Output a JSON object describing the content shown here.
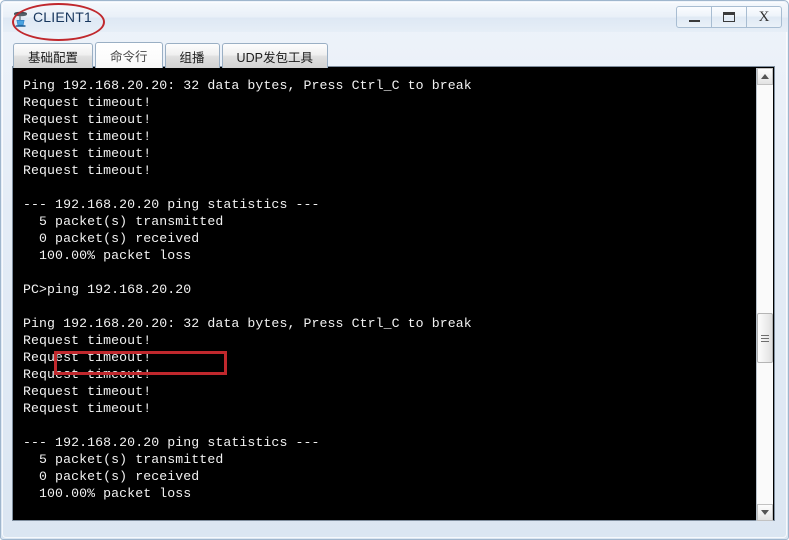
{
  "window": {
    "title": "CLIENT1",
    "icon": "pc-device-icon",
    "controls": {
      "minimize_label": "—",
      "maximize_label": "❐",
      "close_label": "X",
      "minimize_name": "minimize",
      "maximize_name": "maximize",
      "close_name": "close"
    },
    "frame_color": "#9fb6cd",
    "title_color": "#17365d"
  },
  "annotations": {
    "title_ellipse_color": "#c0282d",
    "command_box_color": "#c0282d",
    "command_box_target": "ping 192.168.20.20"
  },
  "tabs": [
    {
      "label": "基础配置",
      "name": "tab-basic-config",
      "active": false
    },
    {
      "label": "命令行",
      "name": "tab-command-line",
      "active": true
    },
    {
      "label": "组播",
      "name": "tab-multicast",
      "active": false
    },
    {
      "label": "UDP发包工具",
      "name": "tab-udp-tool",
      "active": false
    }
  ],
  "terminal": {
    "background": "#000000",
    "foreground": "#f2f2f2",
    "lines": [
      "Ping 192.168.20.20: 32 data bytes, Press Ctrl_C to break",
      "Request timeout!",
      "Request timeout!",
      "Request timeout!",
      "Request timeout!",
      "Request timeout!",
      "",
      "--- 192.168.20.20 ping statistics ---",
      "  5 packet(s) transmitted",
      "  0 packet(s) received",
      "  100.00% packet loss",
      "",
      "PC>ping 192.168.20.20",
      "",
      "Ping 192.168.20.20: 32 data bytes, Press Ctrl_C to break",
      "Request timeout!",
      "Request timeout!",
      "Request timeout!",
      "Request timeout!",
      "Request timeout!",
      "",
      "--- 192.168.20.20 ping statistics ---",
      "  5 packet(s) transmitted",
      "  0 packet(s) received",
      "  100.00% packet loss",
      ""
    ]
  },
  "scrollbar": {
    "up_arrow": "scroll-up-arrow-icon",
    "down_arrow": "scroll-down-arrow-icon",
    "thumb_position_percent": 55
  }
}
